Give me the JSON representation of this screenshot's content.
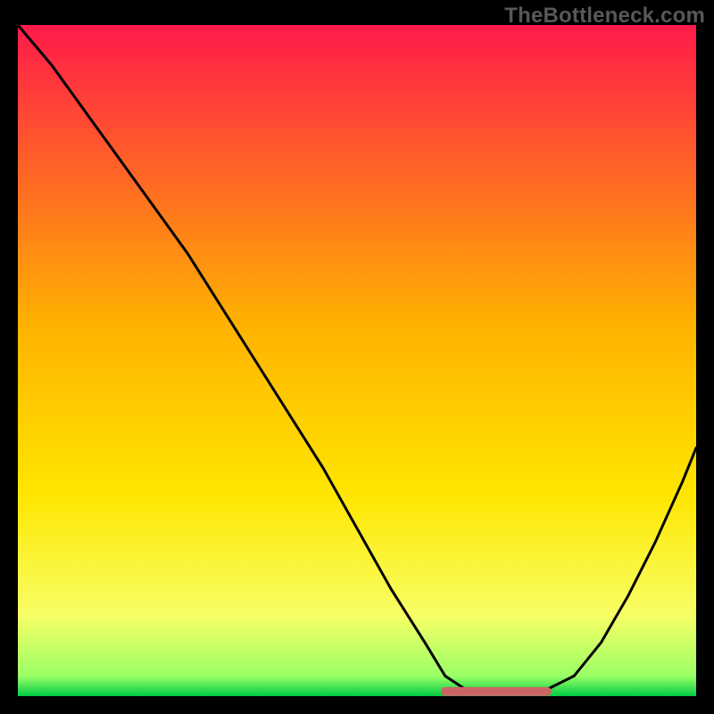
{
  "watermark": "TheBottleneck.com",
  "colors": {
    "page_bg": "#000000",
    "curve": "#000000",
    "segment": "#cc6666",
    "gradient_stops": [
      {
        "offset": "0%",
        "color": "#ff1a4a"
      },
      {
        "offset": "45%",
        "color": "#ffb300"
      },
      {
        "offset": "70%",
        "color": "#ffe600"
      },
      {
        "offset": "88%",
        "color": "#f7ff66"
      },
      {
        "offset": "97%",
        "color": "#9bff66"
      },
      {
        "offset": "100%",
        "color": "#00cc44"
      }
    ]
  },
  "chart_data": {
    "type": "line",
    "title": "",
    "xlabel": "",
    "ylabel": "",
    "xlim": [
      0,
      100
    ],
    "ylim": [
      0,
      100
    ],
    "grid": false,
    "legend": false,
    "series": [
      {
        "name": "bottleneck-curve",
        "x": [
          0,
          5,
          10,
          15,
          20,
          25,
          30,
          35,
          40,
          45,
          50,
          55,
          60,
          63,
          66,
          69,
          72,
          75,
          78,
          82,
          86,
          90,
          94,
          98,
          100
        ],
        "values": [
          100,
          94,
          87,
          80,
          73,
          66,
          58,
          50,
          42,
          34,
          25,
          16,
          8,
          3,
          1,
          0.6,
          0.5,
          0.5,
          1,
          3,
          8,
          15,
          23,
          32,
          37
        ]
      }
    ],
    "highlight_segment": {
      "name": "optimal-range",
      "x_range": [
        63,
        78
      ],
      "y": 0.7,
      "stroke_width": 10
    }
  }
}
